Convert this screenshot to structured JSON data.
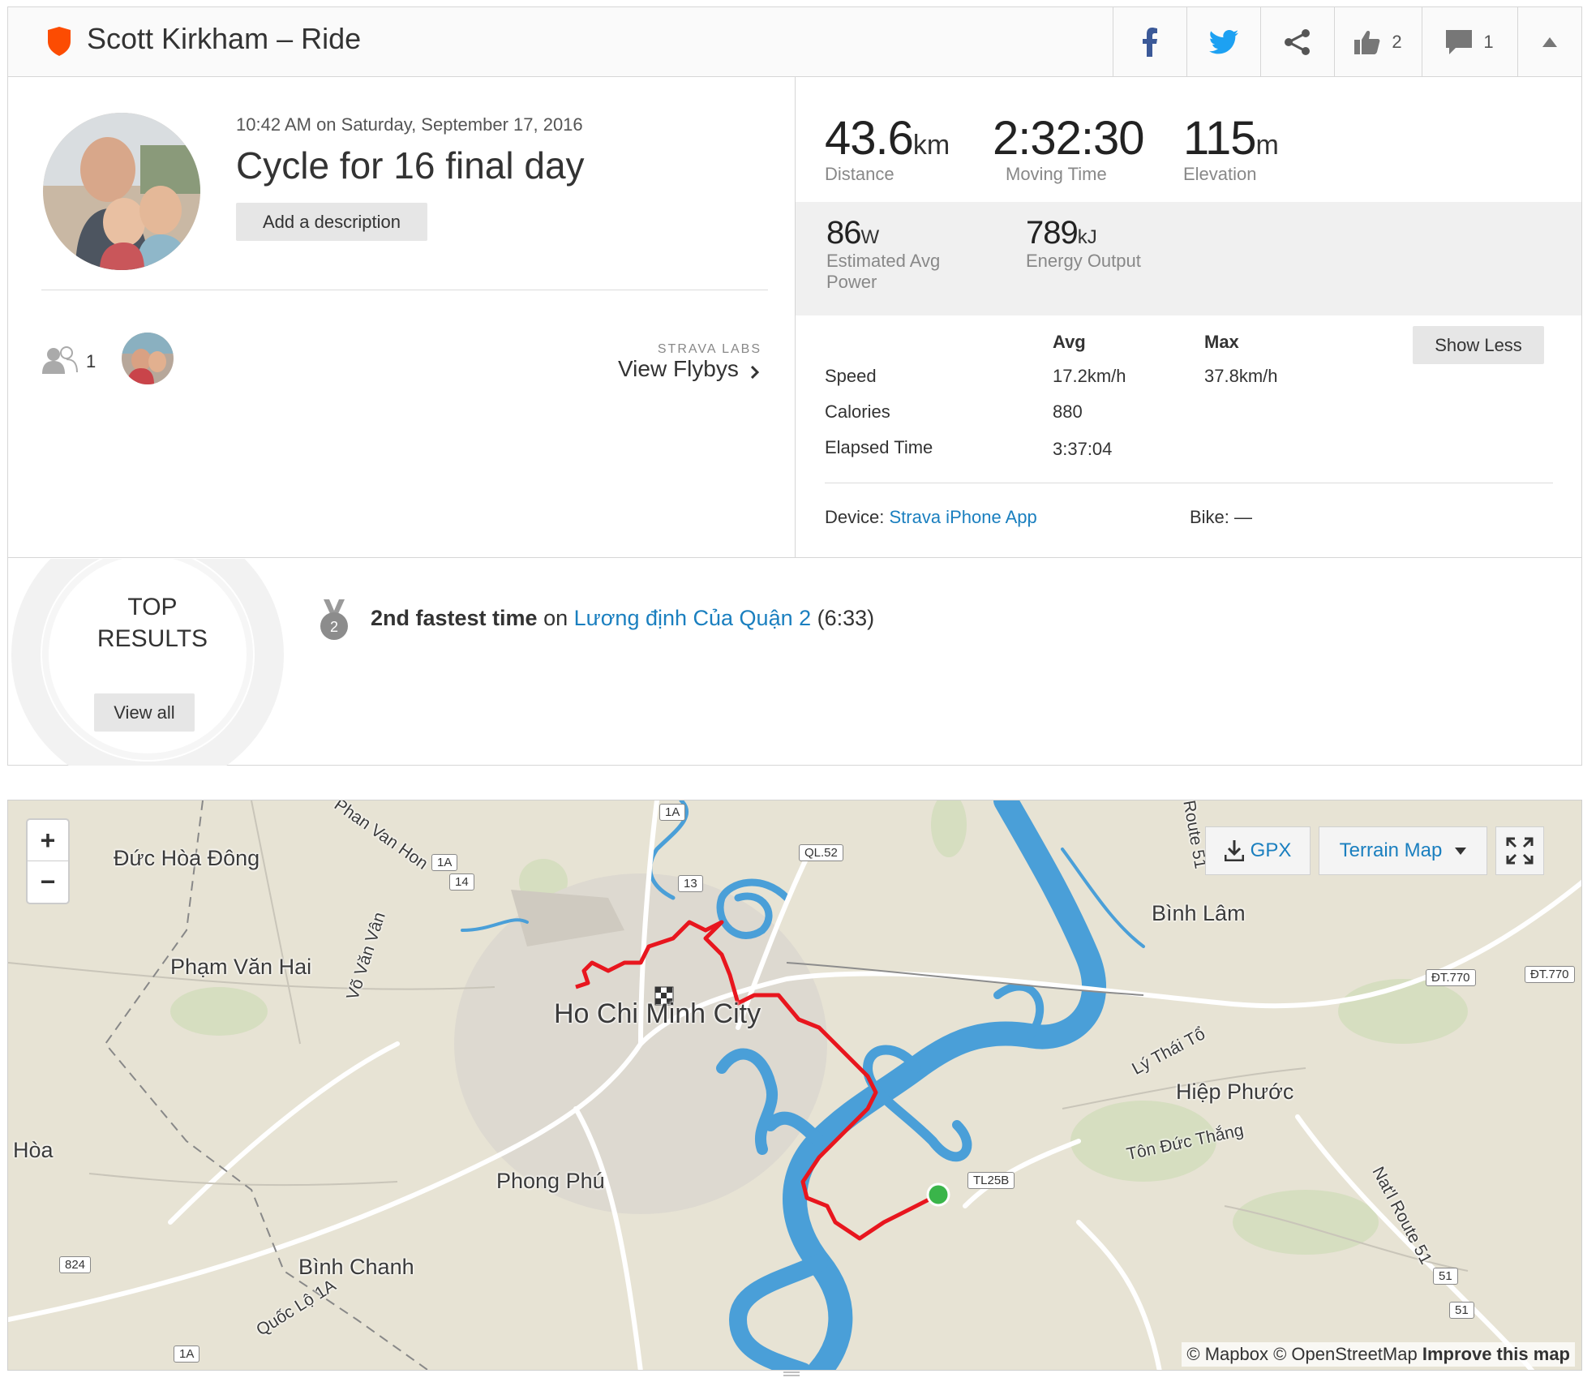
{
  "header": {
    "title": "Scott Kirkham – Ride",
    "kudos_count": "2",
    "comments_count": "1"
  },
  "activity": {
    "date": "10:42 AM on Saturday, September 17, 2016",
    "name": "Cycle for 16 final day",
    "add_description": "Add a description",
    "athlete_count": "1",
    "labs_label": "STRAVA LABS",
    "flybys_label": "View Flybys"
  },
  "stats": {
    "distance": {
      "value": "43.6",
      "unit": "km",
      "label": "Distance"
    },
    "moving_time": {
      "value": "2:32:30",
      "label": "Moving Time"
    },
    "elevation": {
      "value": "115",
      "unit": "m",
      "label": "Elevation"
    },
    "power": {
      "value": "86",
      "unit": "W",
      "label_1": "Estimated Avg",
      "label_2": "Power"
    },
    "energy": {
      "value": "789",
      "unit": "kJ",
      "label": "Energy Output"
    }
  },
  "more_stats": {
    "avg_header": "Avg",
    "max_header": "Max",
    "show_less": "Show Less",
    "rows": [
      {
        "label": "Speed",
        "avg": "17.2km/h",
        "max": "37.8km/h"
      },
      {
        "label": "Calories",
        "avg": "880",
        "max": ""
      },
      {
        "label": "Elapsed Time",
        "avg": "3:37:04",
        "max": ""
      }
    ],
    "device_label": "Device:",
    "device_value": "Strava iPhone App",
    "bike_label": "Bike:",
    "bike_value": "—"
  },
  "results": {
    "title_1": "TOP",
    "title_2": "RESULTS",
    "view_all": "View all",
    "medal_rank": "2",
    "achievement_bold": "2nd fastest time",
    "achievement_on": "on",
    "segment": "Lương định Của Quận 2",
    "time": "(6:33)"
  },
  "map": {
    "zoom_in": "+",
    "zoom_out": "−",
    "gpx_label": "GPX",
    "map_type": "Terrain Map",
    "attribution_1": "© Mapbox © OpenStreetMap",
    "attribution_2": "Improve this map",
    "places": {
      "duc_hoa_dong": "Đức Hòa Đông",
      "pham_van_hai": "Phạm Văn Hai",
      "hoa": "Hòa",
      "ho_chi_minh": "Ho Chi Minh City",
      "phong_phu": "Phong Phú",
      "binh_chanh": "Bình Chanh",
      "binh_lam": "Bình Lâm",
      "hiep_phuoc": "Hiệp Phước",
      "ton_duc_thang": "Tôn Đức Thắng",
      "ly_thai_to": "Lý Thái Tổ",
      "natl_route_51": "Nat'l Route 51",
      "route_51": "Route 51",
      "pham_van_hon": "Phan Van Hon",
      "vo_van_van": "Võ Văn Vân",
      "quoc_lo_1a": "Quốc Lộ 1A"
    },
    "shields": {
      "s1a_top": "1A",
      "s1a_mid": "1A",
      "s14": "14",
      "s13": "13",
      "sql52": "QL.52",
      "sdt770": "ĐT.770",
      "sdt770b": "ĐT.770",
      "stl25b": "TL25B",
      "s824": "824",
      "s1a_bot": "1A",
      "s51a": "51",
      "s51b": "51"
    }
  },
  "colors": {
    "strava_orange": "#fc4c02",
    "link_blue": "#1a7fbf",
    "route_red": "#e8161e",
    "water_blue": "#4a9fd8",
    "start_green": "#3ab54a"
  }
}
